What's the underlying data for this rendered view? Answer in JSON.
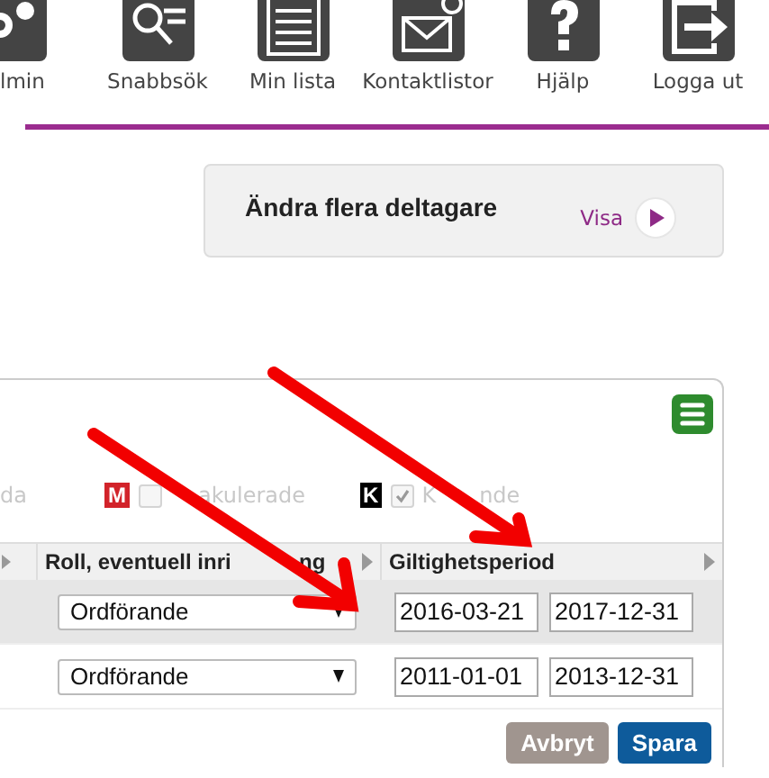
{
  "nav": [
    {
      "label": "lmin",
      "kind": "gears"
    },
    {
      "label": "Snabbsök",
      "kind": "search"
    },
    {
      "label": "Min lista",
      "kind": "list"
    },
    {
      "label": "Kontaktlistor",
      "kind": "mail"
    },
    {
      "label": "Hjälp",
      "kind": "help"
    },
    {
      "label": "Logga ut",
      "kind": "logout"
    }
  ],
  "card": {
    "title": "Ändra flera deltagare",
    "action": "Visa"
  },
  "legend": [
    {
      "kind": "text",
      "label": "da"
    },
    {
      "kind": "filter",
      "badge": "M",
      "label_parts": [
        "akulerade"
      ],
      "checked": false,
      "color": "#d2232a"
    },
    {
      "kind": "filter",
      "badge": "K",
      "label_parts": [
        "K",
        "nde"
      ],
      "checked": true,
      "color": "#000000"
    }
  ],
  "table": {
    "columns": [
      [
        "Roll, eventuell inri",
        "ng"
      ],
      [
        "Giltighetsperiod"
      ]
    ],
    "rows": [
      {
        "role": "Ordförande",
        "from": "2016-03-21",
        "to": "2017-12-31",
        "selected": true
      },
      {
        "role": "Ordförande",
        "from": "2011-01-01",
        "to": "2013-12-31",
        "selected": false
      }
    ]
  },
  "buttons": [
    {
      "label": "Avbryt",
      "kind": "cancel"
    },
    {
      "label": "Spara",
      "kind": "primary"
    }
  ]
}
